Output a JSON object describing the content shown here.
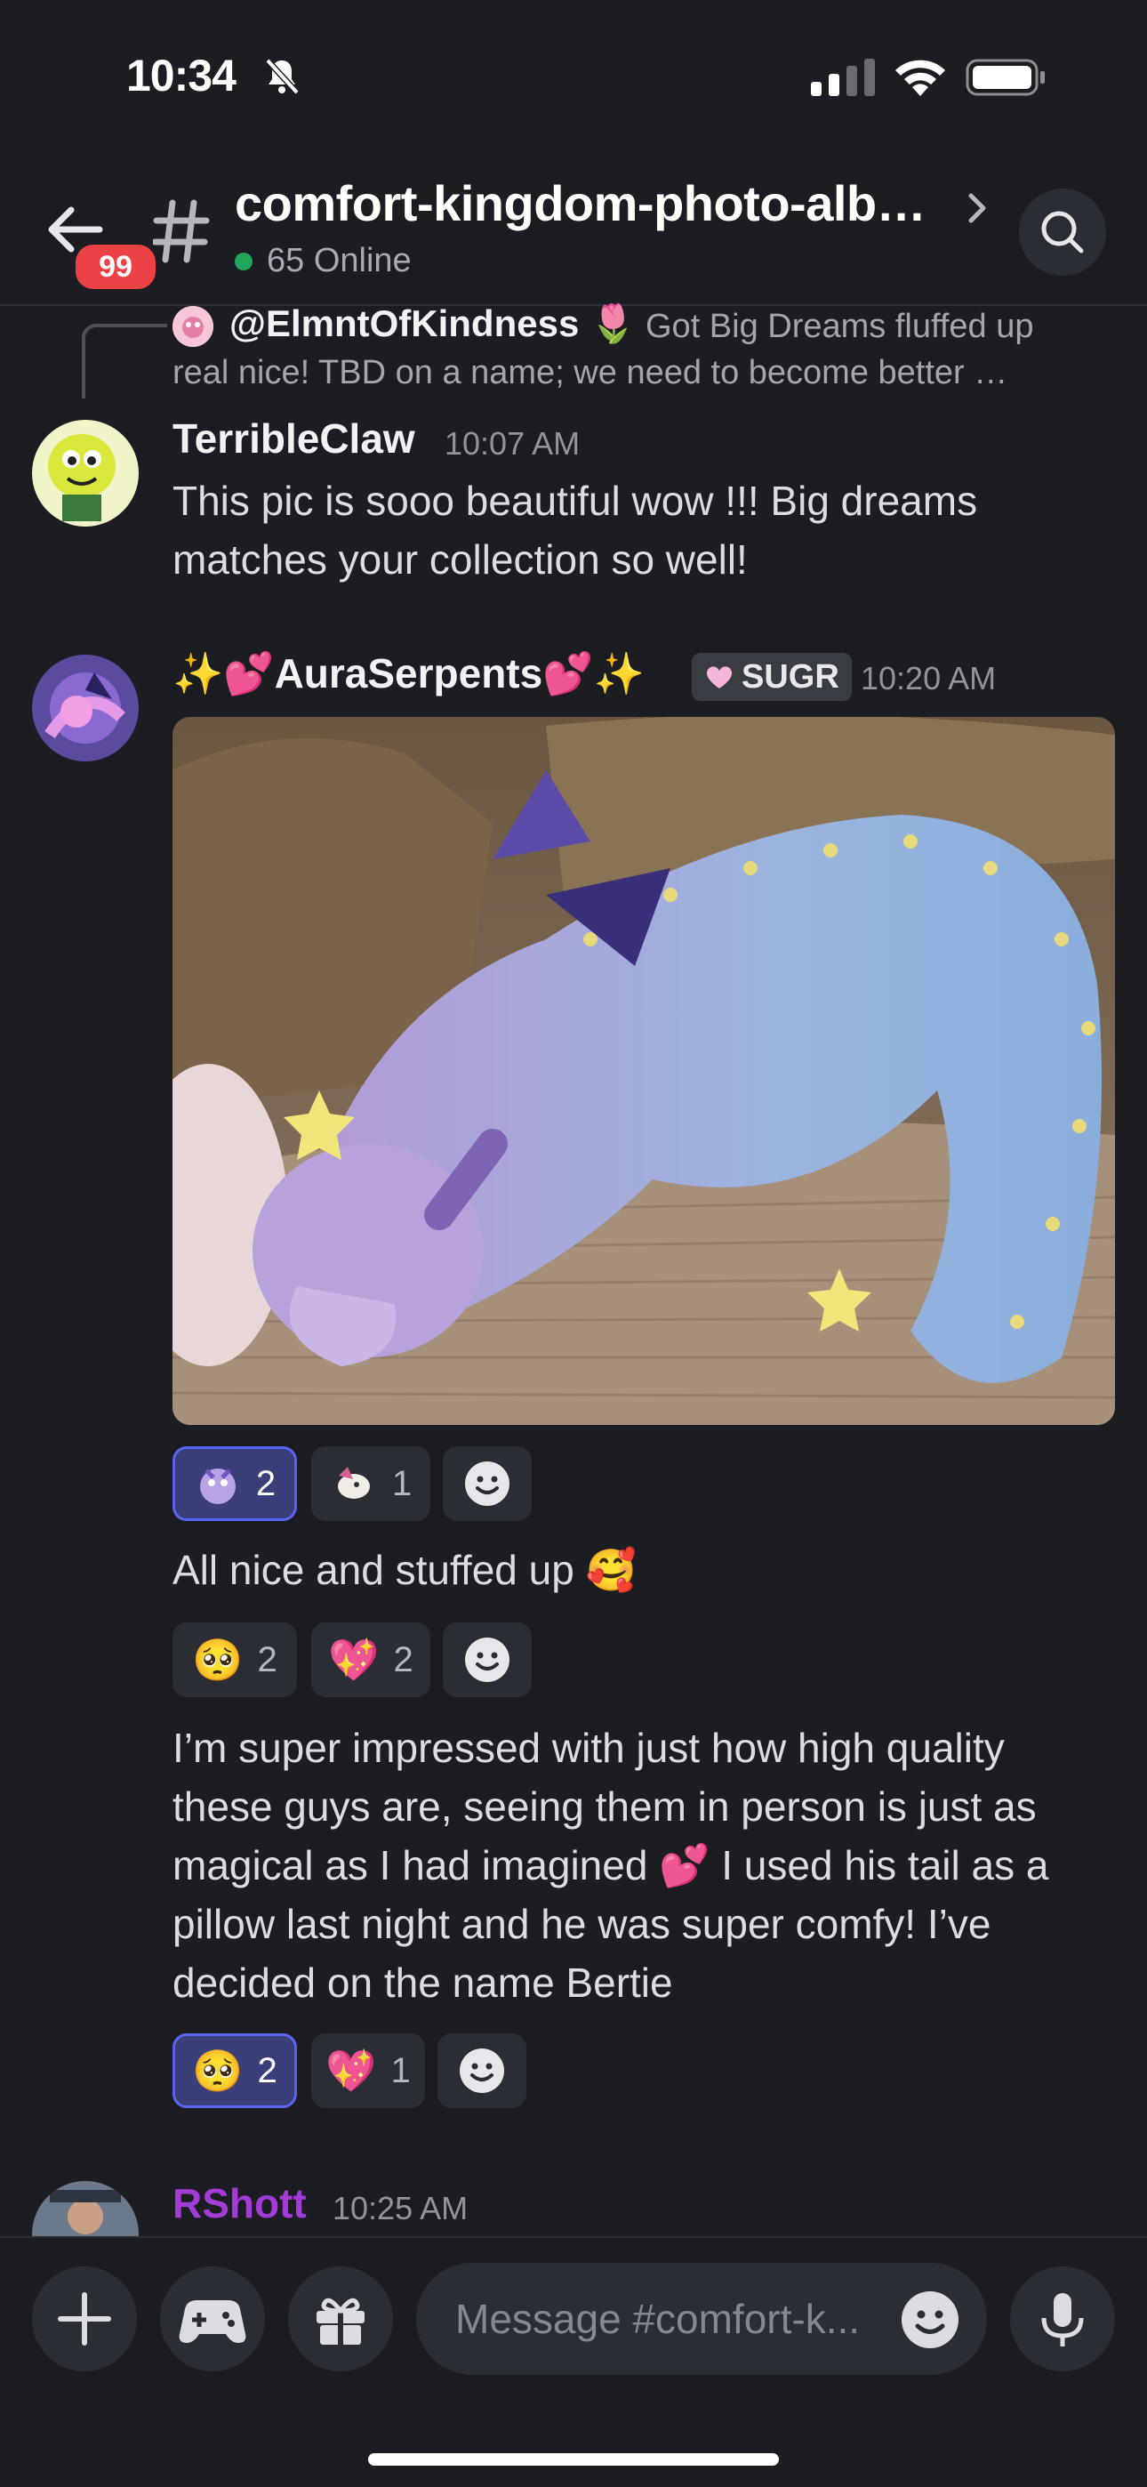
{
  "status_bar": {
    "time": "10:34"
  },
  "header": {
    "unread_badge": "99",
    "channel_title": "comfort-kingdom-photo-alb…",
    "online_text": "65 Online"
  },
  "reply": {
    "name": "@ElmntOfKindness",
    "emoji": "🌷",
    "text_line1": "Got Big Dreams fluffed up",
    "text_line2": "real nice! TBD on a name; we need to become better …"
  },
  "messages": [
    {
      "author": "TerribleClaw",
      "timestamp": "10:07 AM",
      "text_line1": "This pic is sooo beautiful wow !!! Big dreams",
      "text_line2": "matches your collection so well!"
    },
    {
      "author_prefix": "✨💕",
      "author": "AuraSerpents",
      "author_suffix": "💕✨",
      "tag": "SUGR",
      "timestamp": "10:20 AM",
      "reactions_photo": [
        {
          "count": "2",
          "active": true
        },
        {
          "count": "1",
          "active": false
        }
      ],
      "text1": "All nice and stuffed up 🥰",
      "reactions_text1": [
        {
          "emoji": "🥺",
          "count": "2"
        },
        {
          "emoji": "💖",
          "count": "2"
        }
      ],
      "text2_lines": [
        "I’m super impressed with just how high quality",
        "these guys are, seeing them in person is just as",
        "magical as I had imagined 💕 I used his tail as a",
        "pillow last night and he was super comfy! I’ve",
        "decided on the name Bertie"
      ],
      "reactions_text2": [
        {
          "emoji": "🥺",
          "count": "2",
          "active": true
        },
        {
          "emoji": "💖",
          "count": "1"
        }
      ]
    },
    {
      "author": "RShott",
      "timestamp": "10:25 AM",
      "color": "#a33bd6"
    }
  ],
  "input": {
    "placeholder": "Message #comfort-k..."
  }
}
